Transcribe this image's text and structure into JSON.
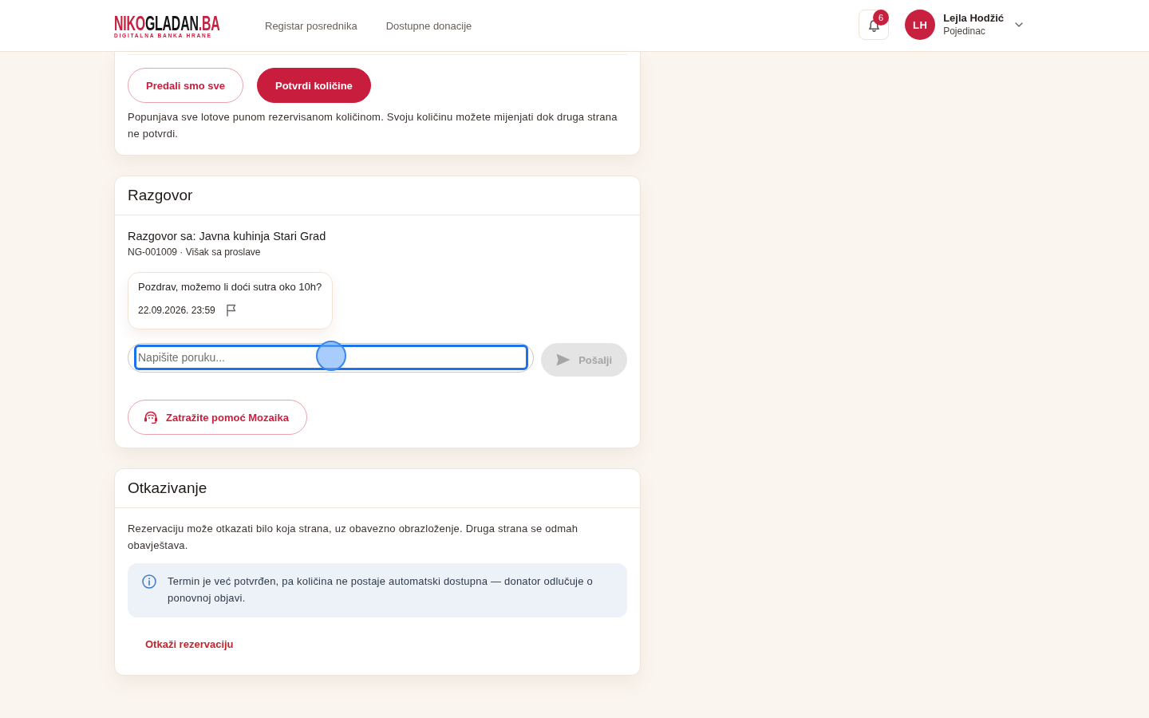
{
  "header": {
    "logo": {
      "parts": [
        {
          "text": "NIKO",
          "color": "#c8203f"
        },
        {
          "text": "GLADAN",
          "color": "#141414"
        },
        {
          "text": ".BA",
          "color": "#c8203f"
        }
      ],
      "tagline": "DIGITALNA BANKA HRANE"
    },
    "nav": [
      {
        "label": "Registar posrednika",
        "selected": false
      },
      {
        "label": "Dostupne donacije",
        "selected": false
      }
    ],
    "notifications": {
      "count": "6"
    },
    "user": {
      "initials": "LH",
      "name": "Lejla Hodžić",
      "role": "Pojedinac"
    }
  },
  "confirm_card": {
    "buttons": [
      {
        "label": "Predali smo sve",
        "kind": "outline"
      },
      {
        "label": "Potvrdi količine",
        "kind": "primary"
      }
    ],
    "note": "Popunjava sve lotove punom rezervisanom količinom. Svoju količinu možete mijenjati dok druga strana ne potvrdi."
  },
  "chat_card": {
    "title": "Razgovor",
    "partner": "Razgovor sa: Javna kuhinja Stari Grad",
    "reference": "NG-001009 · Višak sa proslave",
    "messages": [
      {
        "text": "Pozdrav, možemo li doći sutra oko 10h?",
        "time": "22.09.2026. 23:59"
      }
    ],
    "composer": {
      "placeholder": "Napišite poruku...",
      "focused": true
    },
    "send_button": {
      "label": "Pošalji",
      "disabled": true
    },
    "help_button": {
      "label": "Zatražite pomoć Mozaika"
    }
  },
  "cancel_card": {
    "title": "Otkazivanje",
    "text": "Rezervaciju može otkazati bilo koja strana, uz obavezno obrazloženje. Druga strana se odmah obavještava.",
    "notice": "Termin je već potvrđen, pa količina ne postaje automatski dostupna — donator odlučuje o ponovnoj objavi.",
    "cancel_link": "Otkaži rezervaciju"
  }
}
